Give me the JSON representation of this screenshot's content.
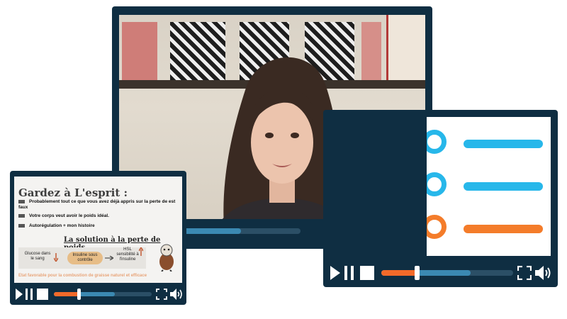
{
  "main_video": {
    "progress": 0.31,
    "buffered": 0.66
  },
  "slide_player": {
    "slide": {
      "title": "Gardez à L'esprit :",
      "bullets": [
        "Probablement tout ce que vous avez déjà appris sur la perte de est faux",
        "Votre corps veut avoir le poids idéal.",
        "Autorégulation + mon histoire"
      ],
      "subtitle": "La solution à la perte de poids",
      "diagram": {
        "left": "Glucose dans le sang",
        "center": "Insuline sous contrôle",
        "right": "HSL sensibilité à l'insuline"
      },
      "footnote": "Etat favorable pour la combustion de graisse naturel et efficace"
    },
    "progress": 0.26,
    "buffered": 0.62
  },
  "quiz_player": {
    "items": [
      {
        "color": "#27b7ea"
      },
      {
        "color": "#27b7ea"
      },
      {
        "color": "#f47c2a"
      }
    ],
    "progress": 0.27,
    "buffered": 0.68
  },
  "colors": {
    "frame": "#0f2e42",
    "accent_orange": "#f26a2a",
    "accent_blue": "#3b89b2",
    "quiz_blue": "#27b7ea",
    "quiz_orange": "#f47c2a"
  },
  "icons": [
    "play-icon",
    "pause-icon",
    "stop-icon",
    "fullscreen-icon",
    "volume-icon"
  ]
}
